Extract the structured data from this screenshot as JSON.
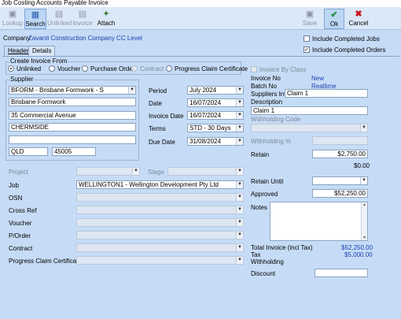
{
  "window": {
    "title": "Job Costing Accounts Payable Invoice"
  },
  "toolbar": {
    "lookup": "Lookup",
    "search": "Search",
    "unlinked": "Unlinked",
    "invoice": "Invoice",
    "attach": "Attach",
    "save": "Save",
    "ok": "Ok",
    "cancel": "Cancel"
  },
  "company": {
    "label": "Company",
    "value": "Zavanti Construction Company CC Level"
  },
  "options": {
    "include_completed_jobs": "Include Completed Jobs",
    "include_completed_orders": "Include Completed Orders"
  },
  "tabs": {
    "header": "Header",
    "details": "Details"
  },
  "create_from": {
    "title": "Create Invoice From",
    "unlinked": "Unlinked",
    "voucher": "Voucher",
    "purchase_order": "Purchase Order",
    "contract": "Contract",
    "progress_claim": "Progress Claim Certificate",
    "selected": "Unlinked"
  },
  "supplier": {
    "title": "Supplier",
    "code": "BFORM - Brisbane Formwork - S",
    "name": "Brisbane Formwork",
    "address1": "35 Commercial Avenue",
    "suburb": "CHERMSIDE",
    "address3": "",
    "state": "QLD",
    "postcode": "45005"
  },
  "dates": {
    "period_label": "Period",
    "period": "July 2024",
    "date_label": "Date",
    "date": "16/07/2024",
    "invoice_date_label": "Invoice Date",
    "invoice_date": "16/07/2024",
    "terms_label": "Terms",
    "terms": "STD - 30 Days",
    "due_date_label": "Due Date",
    "due_date": "31/08/2024"
  },
  "job_fields": {
    "project_label": "Project",
    "stage_label": "Stage",
    "job_label": "Job",
    "job": "WELLINGTON1 - Wellington Development Pty Ltd",
    "osn_label": "OSN",
    "cross_ref_label": "Cross Ref",
    "voucher_label": "Voucher",
    "porder_label": "P/Order",
    "contract_label": "Contract",
    "pcc_label": "Progress Claim Certificate"
  },
  "invoice": {
    "by_class_label": "Invoice By Class",
    "invoice_no_label": "Invoice No",
    "invoice_no": "New",
    "batch_no_label": "Batch No",
    "batch_no": "Realtime",
    "suppliers_inv_label": "Suppliers Inv.",
    "suppliers_inv": "Claim 1",
    "description_label": "Description",
    "description": "Claim 1",
    "withholding_code_label": "Withholding Code",
    "withholding_pct_label": "Withholding %",
    "retain_label": "Retain",
    "retain": "$2,750.00",
    "retain_sub": "$0.00",
    "retain_until_label": "Retain Until",
    "approved_label": "Approved",
    "approved": "$52,250.00",
    "notes_label": "Notes",
    "total_label": "Total Invoice (incl Tax)",
    "total": "$52,250.00",
    "tax_label": "Tax",
    "tax": "$5,000.00",
    "withholding_label": "Withholding",
    "discount_label": "Discount"
  },
  "colors": {
    "background": "#c6dcf6",
    "link_blue": "#1b3fb0",
    "ok_check": "#1c8a3a",
    "cancel_x": "#c8161c"
  }
}
